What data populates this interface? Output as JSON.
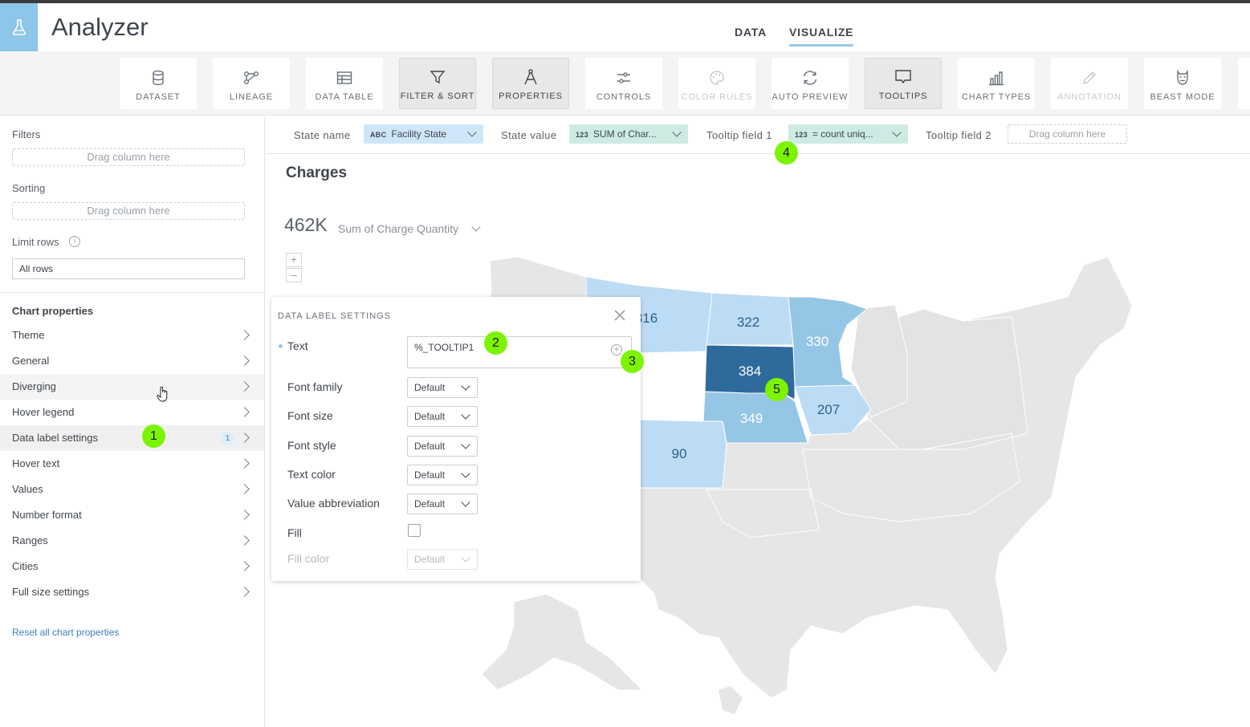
{
  "app": {
    "title": "Analyzer"
  },
  "nav": {
    "tabs": [
      {
        "label": "DATA"
      },
      {
        "label": "VISUALIZE"
      }
    ]
  },
  "toolbar": {
    "items": [
      {
        "label": "DATASET",
        "icon": "database-icon",
        "state": "normal"
      },
      {
        "label": "LINEAGE",
        "icon": "lineage-icon",
        "state": "normal"
      },
      {
        "label": "DATA TABLE",
        "icon": "table-icon",
        "state": "normal"
      },
      {
        "label": "FILTER & SORT",
        "icon": "filter-icon",
        "state": "active"
      },
      {
        "label": "PROPERTIES",
        "icon": "compass-icon",
        "state": "active"
      },
      {
        "label": "CONTROLS",
        "icon": "sliders-icon",
        "state": "normal"
      },
      {
        "label": "COLOR RULES",
        "icon": "palette-icon",
        "state": "disabled"
      },
      {
        "label": "AUTO PREVIEW",
        "icon": "refresh-icon",
        "state": "normal"
      },
      {
        "label": "TOOLTIPS",
        "icon": "tooltip-icon",
        "state": "active"
      },
      {
        "label": "CHART TYPES",
        "icon": "bar-chart-icon",
        "state": "normal"
      },
      {
        "label": "ANNOTATION",
        "icon": "pencil-icon",
        "state": "disabled"
      },
      {
        "label": "BEAST MODE",
        "icon": "beast-icon",
        "state": "normal"
      }
    ]
  },
  "left": {
    "filters_label": "Filters",
    "filters_drop": "Drag column here",
    "sorting_label": "Sorting",
    "sorting_drop": "Drag column here",
    "limit_label": "Limit rows",
    "limit_value": "All rows",
    "chart_properties_title": "Chart properties",
    "properties": [
      {
        "label": "Theme"
      },
      {
        "label": "General"
      },
      {
        "label": "Diverging"
      },
      {
        "label": "Hover legend"
      },
      {
        "label": "Data label settings",
        "badge": "1"
      },
      {
        "label": "Hover text"
      },
      {
        "label": "Values"
      },
      {
        "label": "Number format"
      },
      {
        "label": "Ranges"
      },
      {
        "label": "Cities"
      },
      {
        "label": "Full size settings"
      }
    ],
    "reset_label": "Reset all chart properties"
  },
  "fieldbar": {
    "state_name_label": "State name",
    "state_name_type": "ABC",
    "state_name_value": "Facility State",
    "state_value_label": "State value",
    "state_value_type": "123",
    "state_value_value": "SUM of Char...",
    "tooltip1_label": "Tooltip field 1",
    "tooltip1_type": "123",
    "tooltip1_value": "= count uniq...",
    "tooltip2_label": "Tooltip field 2",
    "tooltip2_drop": "Drag column here"
  },
  "chart": {
    "title": "Charges",
    "summary_value": "462K",
    "summary_label": "Sum of Charge Quantity",
    "zoom_in": "+",
    "zoom_out": "–",
    "state_labels": {
      "montana": "316",
      "north_dakota": "322",
      "minnesota": "330",
      "south_dakota": "384",
      "nebraska": "349",
      "iowa": "207",
      "colorado": "90"
    },
    "colors": {
      "light": "#bcdcf5",
      "mid": "#96c6e6",
      "dark": "#2f6a9c",
      "empty": "#e6e6e6"
    }
  },
  "dialog": {
    "title": "DATA LABEL SETTINGS",
    "text_label": "Text",
    "text_value": "%_TOOLTIP1",
    "plus": "+",
    "font_family_label": "Font family",
    "font_family_value": "Default",
    "font_size_label": "Font size",
    "font_size_value": "Default",
    "font_style_label": "Font style",
    "font_style_value": "Default",
    "text_color_label": "Text color",
    "text_color_value": "Default",
    "value_abbr_label": "Value abbreviation",
    "value_abbr_value": "Default",
    "fill_label": "Fill",
    "fill_color_label": "Fill color",
    "fill_color_value": "Default"
  },
  "callouts": [
    "1",
    "2",
    "3",
    "4",
    "5"
  ]
}
